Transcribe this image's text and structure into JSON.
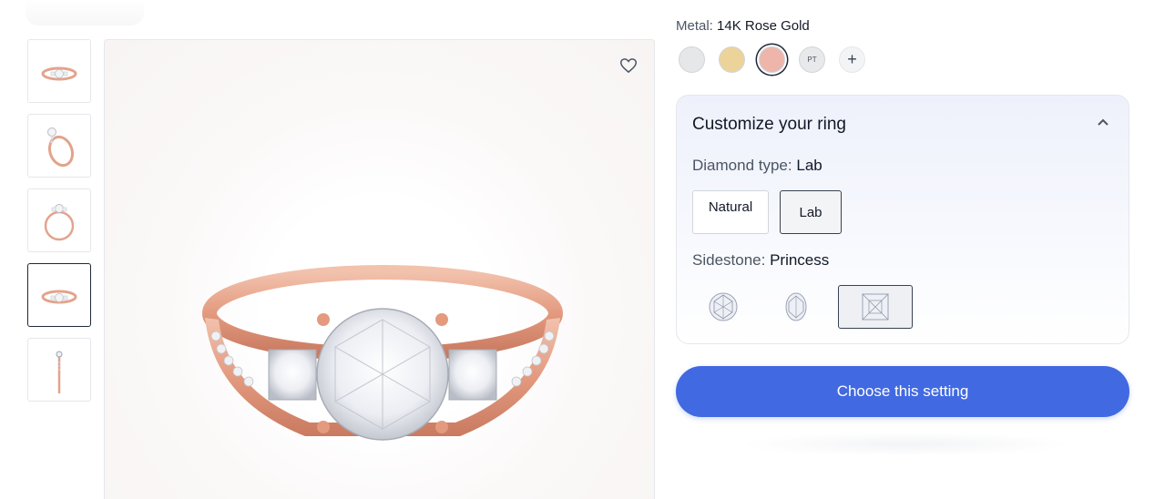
{
  "gallery": {
    "thumbnails": [
      {
        "view": "front"
      },
      {
        "view": "angled"
      },
      {
        "view": "side"
      },
      {
        "view": "front",
        "active": true
      },
      {
        "view": "profile"
      }
    ]
  },
  "metal": {
    "label": "Metal:",
    "selected": "14K Rose Gold",
    "options": [
      {
        "color": "#e5e7e8"
      },
      {
        "color": "#ecd39a"
      },
      {
        "color": "#eeb5aa",
        "selected": true
      },
      {
        "text": "PT",
        "color": "#e8e9ea"
      },
      {
        "text": "+",
        "color": "#f3f4f6"
      }
    ]
  },
  "customize": {
    "title": "Customize your ring",
    "diamond_type_label": "Diamond type:",
    "diamond_type_value": "Lab",
    "diamond_options": [
      "Natural",
      "Lab"
    ],
    "sidestone_label": "Sidestone:",
    "sidestone_value": "Princess",
    "sidestone_options": [
      "round-stone-icon",
      "oval-stone-icon",
      "princess-stone-icon"
    ]
  },
  "cta": {
    "label": "Choose this setting"
  },
  "colors": {
    "accent": "#4169e1",
    "rose_gold": "#e8a58e"
  }
}
